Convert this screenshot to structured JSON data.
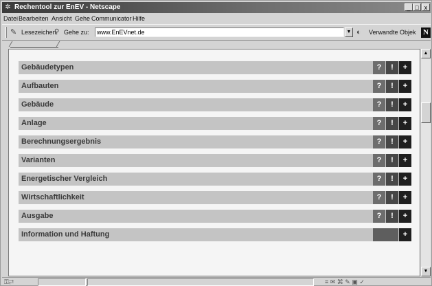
{
  "window": {
    "title": "Rechentool zur EnEV - Netscape",
    "controls": {
      "minimize": "_",
      "maximize": "□",
      "close": "x"
    }
  },
  "menu": [
    "Datei",
    "Bearbeiten",
    "Ansicht",
    "Gehe",
    "Communicator",
    "Hilfe"
  ],
  "location_bar": {
    "bookmarks_label": "Lesezeichen",
    "goto_label": "Gehe zu:",
    "url": "www.EnEVnet.de",
    "related_label": "Verwandte Objek",
    "logo_letter": "N"
  },
  "nav_rows": [
    {
      "label": "Gebäudetypen",
      "buttons": [
        "?",
        "!",
        "+"
      ]
    },
    {
      "label": "Aufbauten",
      "buttons": [
        "?",
        "!",
        "+"
      ]
    },
    {
      "label": "Gebäude",
      "buttons": [
        "?",
        "!",
        "+"
      ]
    },
    {
      "label": "Anlage",
      "buttons": [
        "?",
        "!",
        "+"
      ]
    },
    {
      "label": "Berechnungsergebnis",
      "buttons": [
        "?",
        "!",
        "+"
      ]
    },
    {
      "label": "Varianten",
      "buttons": [
        "?",
        "!",
        "+"
      ]
    },
    {
      "label": "Energetischer Vergleich",
      "buttons": [
        "?",
        "!",
        "+"
      ]
    },
    {
      "label": "Wirtschaftlichkeit",
      "buttons": [
        "?",
        "!",
        "+"
      ]
    },
    {
      "label": "Ausgabe",
      "buttons": [
        "?",
        "!",
        "+"
      ]
    },
    {
      "label": "Information und Haftung",
      "buttons": [
        "+"
      ]
    }
  ],
  "icons": [
    "netscape-app-icon",
    "bookmarks-icon",
    "goto-icon",
    "related-icon",
    "netscape-logo",
    "scroll-up-icon",
    "scroll-down-icon",
    "status-icons"
  ],
  "colors": {
    "row_bg": "#c4c4c4",
    "row_text": "#3a3a3a",
    "btn_help": "#6d6d6d",
    "btn_info": "#474747",
    "btn_open": "#1f1f1f"
  }
}
